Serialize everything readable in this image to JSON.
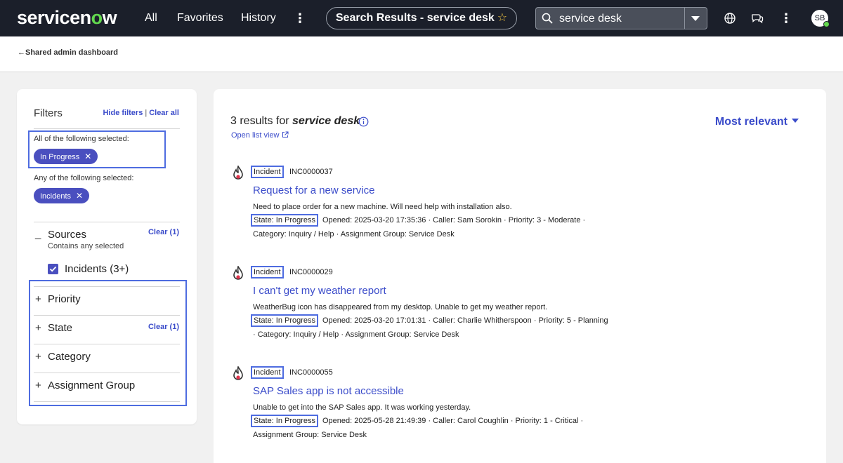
{
  "topbar": {
    "logo": "servicenow",
    "logo_prefix": "servicen",
    "logo_o": "o",
    "logo_suffix": "w",
    "nav": [
      "All",
      "Favorites",
      "History"
    ],
    "context_pill": "Search Results - service desk",
    "search_value": "service desk",
    "avatar_initials": "SB",
    "icons": [
      "globe-icon",
      "chat-icon",
      "kebab-icon",
      "search-icon",
      "star-icon"
    ],
    "colors": {
      "background": "#1b1f2a",
      "brand_green": "#62d84e"
    }
  },
  "subheader": {
    "back_link": "Shared admin dashboard"
  },
  "filters": {
    "title": "Filters",
    "hide_filters": "Hide filters",
    "separator": "|",
    "clear_all": "Clear all",
    "all_label": "All of the following selected:",
    "all_chips": [
      "In Progress"
    ],
    "any_label": "Any of the following selected:",
    "any_chips": [
      "Incidents"
    ],
    "sources": {
      "toggle": "_",
      "name": "Sources",
      "clear": "Clear (1)",
      "subtitle": "Contains any selected",
      "option": "Incidents (3+)",
      "checked": true
    },
    "facets": [
      {
        "toggle": "+",
        "name": "Priority",
        "clear": ""
      },
      {
        "toggle": "+",
        "name": "State",
        "clear": "Clear (1)"
      },
      {
        "toggle": "+",
        "name": "Category",
        "clear": ""
      },
      {
        "toggle": "+",
        "name": "Assignment Group",
        "clear": ""
      }
    ],
    "colors": {
      "chip": "#4a4fbf",
      "link": "#3b4cca",
      "highlight": "#4e6ce0"
    }
  },
  "results": {
    "count_prefix": "3 results for ",
    "query": "service desk",
    "open_list": "Open list view",
    "sort": "Most relevant",
    "items": [
      {
        "type": "Incident",
        "number": "INC0000037",
        "title": "Request for a new service",
        "description": "Need to place order for a new machine. Will need help with installation also.",
        "state": "State: In Progress",
        "meta1": "Opened: 2025-03-20 17:35:36 · Caller: Sam Sorokin · Priority: 3 - Moderate ·",
        "meta2": "Category: Inquiry / Help · Assignment Group: Service Desk"
      },
      {
        "type": "Incident",
        "number": "INC0000029",
        "title": "I can't get my weather report",
        "description": "WeatherBug icon has disappeared from my desktop. Unable to get my weather report.",
        "state": "State: In Progress",
        "meta1": "Opened: 2025-03-20 17:01:31 · Caller: Charlie Whitherspoon · Priority: 5 - Planning",
        "meta2": "· Category: Inquiry / Help · Assignment Group: Service Desk"
      },
      {
        "type": "Incident",
        "number": "INC0000055",
        "title": "SAP Sales app is not accessible",
        "description": "Unable to get into the SAP Sales app. It was working yesterday.",
        "state": "State: In Progress",
        "meta1": "Opened: 2025-05-28 21:49:39 · Caller: Carol Coughlin · Priority: 1 - Critical ·",
        "meta2": "Assignment Group: Service Desk"
      }
    ]
  }
}
